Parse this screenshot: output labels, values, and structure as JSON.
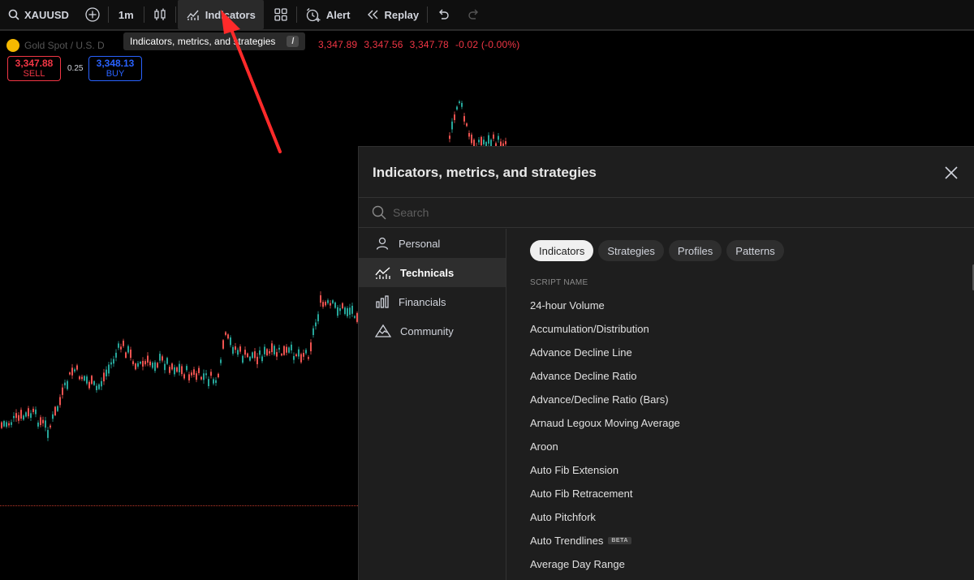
{
  "toolbar": {
    "symbol": "XAUUSD",
    "interval": "1m",
    "indicators_label": "Indicators",
    "alert_label": "Alert",
    "replay_label": "Replay"
  },
  "tooltip": {
    "text": "Indicators, metrics, and strategies",
    "shortcut": "/"
  },
  "chart": {
    "instrument_name": "Gold Spot / U.S. D",
    "ohlc": [
      "3,347.89",
      "3,347.56",
      "3,347.78",
      "-0.02 (-0.00%)"
    ],
    "sell_price": "3,347.88",
    "sell_label": "SELL",
    "spread": "0.25",
    "buy_price": "3,348.13",
    "buy_label": "BUY",
    "up_color": "#26a69a",
    "down_color": "#ef5350"
  },
  "dialog": {
    "title": "Indicators, metrics, and strategies",
    "search_placeholder": "Search",
    "sidebar": [
      {
        "label": "Personal",
        "icon": "person-icon"
      },
      {
        "label": "Technicals",
        "icon": "chart-line-icon",
        "active": true
      },
      {
        "label": "Financials",
        "icon": "bar-chart-icon"
      },
      {
        "label": "Community",
        "icon": "mountain-icon"
      }
    ],
    "tabs": [
      {
        "label": "Indicators",
        "active": true
      },
      {
        "label": "Strategies"
      },
      {
        "label": "Profiles"
      },
      {
        "label": "Patterns"
      }
    ],
    "column_header": "SCRIPT NAME",
    "scripts": [
      {
        "name": "24-hour Volume"
      },
      {
        "name": "Accumulation/Distribution"
      },
      {
        "name": "Advance Decline Line"
      },
      {
        "name": "Advance Decline Ratio"
      },
      {
        "name": "Advance/Decline Ratio (Bars)"
      },
      {
        "name": "Arnaud Legoux Moving Average"
      },
      {
        "name": "Aroon"
      },
      {
        "name": "Auto Fib Extension"
      },
      {
        "name": "Auto Fib Retracement"
      },
      {
        "name": "Auto Pitchfork"
      },
      {
        "name": "Auto Trendlines",
        "badge": "BETA"
      },
      {
        "name": "Average Day Range"
      }
    ]
  }
}
